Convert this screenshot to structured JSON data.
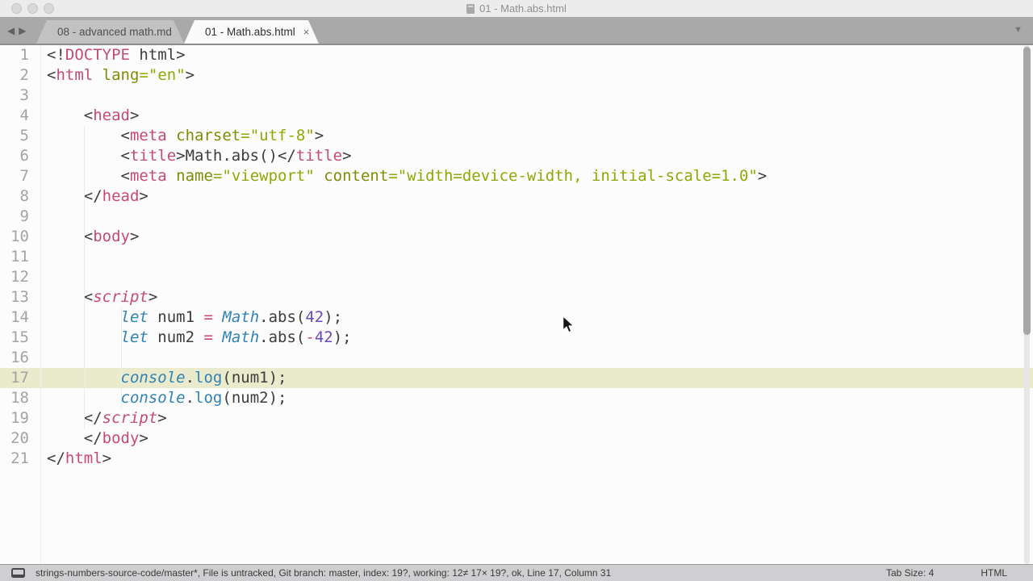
{
  "colors": {
    "c-tag": "#c64a72",
    "c-attr": "#7e8d01",
    "c-string": "#8ea903",
    "c-keyword": "#2f83b5",
    "c-func": "#2f83b5",
    "c-number": "#6a48b8",
    "c-operator": "#d0436f",
    "c-plain": "#3d3d3d",
    "c-linenum": "#a3a3a3",
    "c-highlight": "#eaeacc"
  },
  "window": {
    "title": "01 - Math.abs.html"
  },
  "icons": {
    "back": "◀",
    "forward": "▶",
    "overflow": "▼",
    "close": "×"
  },
  "tabs": [
    {
      "label": "08 - advanced math.md"
    },
    {
      "label": "01 - Math.abs.html"
    }
  ],
  "editor": {
    "highlighted_line": 17,
    "lines": [
      {
        "num": 1,
        "tokens": [
          [
            "p",
            "<!"
          ],
          [
            "t",
            "DOCTYPE"
          ],
          [
            "p",
            " html>"
          ]
        ]
      },
      {
        "num": 2,
        "tokens": [
          [
            "p",
            "<"
          ],
          [
            "t",
            "html"
          ],
          [
            "p",
            " "
          ],
          [
            "a",
            "lang"
          ],
          [
            "s",
            "=\"en\""
          ],
          [
            "p",
            ">"
          ]
        ]
      },
      {
        "num": 3,
        "tokens": []
      },
      {
        "num": 4,
        "tokens": [
          [
            "p",
            "    <"
          ],
          [
            "t",
            "head"
          ],
          [
            "p",
            ">"
          ]
        ]
      },
      {
        "num": 5,
        "tokens": [
          [
            "p",
            "        <"
          ],
          [
            "t",
            "meta"
          ],
          [
            "p",
            " "
          ],
          [
            "a",
            "charset"
          ],
          [
            "s",
            "=\"utf-8\""
          ],
          [
            "p",
            ">"
          ]
        ]
      },
      {
        "num": 6,
        "tokens": [
          [
            "p",
            "        <"
          ],
          [
            "t",
            "title"
          ],
          [
            "p",
            ">Math.abs()</"
          ],
          [
            "t",
            "title"
          ],
          [
            "p",
            ">"
          ]
        ]
      },
      {
        "num": 7,
        "tokens": [
          [
            "p",
            "        <"
          ],
          [
            "t",
            "meta"
          ],
          [
            "p",
            " "
          ],
          [
            "a",
            "name"
          ],
          [
            "s",
            "=\"viewport\""
          ],
          [
            "p",
            " "
          ],
          [
            "a",
            "content"
          ],
          [
            "s",
            "=\"width=device-width, initial-scale=1.0\""
          ],
          [
            "p",
            ">"
          ]
        ]
      },
      {
        "num": 8,
        "tokens": [
          [
            "p",
            "    </"
          ],
          [
            "t",
            "head"
          ],
          [
            "p",
            ">"
          ]
        ]
      },
      {
        "num": 9,
        "tokens": []
      },
      {
        "num": 10,
        "tokens": [
          [
            "p",
            "    <"
          ],
          [
            "t",
            "body"
          ],
          [
            "p",
            ">"
          ]
        ]
      },
      {
        "num": 11,
        "tokens": []
      },
      {
        "num": 12,
        "tokens": []
      },
      {
        "num": 13,
        "tokens": [
          [
            "p",
            "    <"
          ],
          [
            "ti",
            "script"
          ],
          [
            "p",
            ">"
          ]
        ]
      },
      {
        "num": 14,
        "tokens": [
          [
            "p",
            "        "
          ],
          [
            "k",
            "let"
          ],
          [
            "p",
            " num1 "
          ],
          [
            "o",
            "="
          ],
          [
            "p",
            " "
          ],
          [
            "k",
            "Math"
          ],
          [
            "p",
            ".abs("
          ],
          [
            "n",
            "42"
          ],
          [
            "p",
            ");"
          ]
        ]
      },
      {
        "num": 15,
        "tokens": [
          [
            "p",
            "        "
          ],
          [
            "k",
            "let"
          ],
          [
            "p",
            " num2 "
          ],
          [
            "o",
            "="
          ],
          [
            "p",
            " "
          ],
          [
            "k",
            "Math"
          ],
          [
            "p",
            ".abs("
          ],
          [
            "o",
            "-"
          ],
          [
            "n",
            "42"
          ],
          [
            "p",
            ");"
          ]
        ]
      },
      {
        "num": 16,
        "tokens": []
      },
      {
        "num": 17,
        "tokens": [
          [
            "p",
            "        "
          ],
          [
            "k",
            "console"
          ],
          [
            "p",
            "."
          ],
          [
            "f",
            "log"
          ],
          [
            "p",
            "(num1);"
          ]
        ]
      },
      {
        "num": 18,
        "tokens": [
          [
            "p",
            "        "
          ],
          [
            "k",
            "console"
          ],
          [
            "p",
            "."
          ],
          [
            "f",
            "log"
          ],
          [
            "p",
            "(num2);"
          ]
        ]
      },
      {
        "num": 19,
        "tokens": [
          [
            "p",
            "    </"
          ],
          [
            "ti",
            "script"
          ],
          [
            "p",
            ">"
          ]
        ]
      },
      {
        "num": 20,
        "tokens": [
          [
            "p",
            "    </"
          ],
          [
            "t",
            "body"
          ],
          [
            "p",
            ">"
          ]
        ]
      },
      {
        "num": 21,
        "tokens": [
          [
            "p",
            "</"
          ],
          [
            "t",
            "html"
          ],
          [
            "p",
            ">"
          ]
        ]
      }
    ]
  },
  "status_bar": {
    "text": "strings-numbers-source-code/master*, File is untracked, Git branch: master, index: 19?, working: 12≠ 17× 19?, ok, Line 17, Column 31",
    "tab_size": "Tab Size: 4",
    "syntax": "HTML"
  }
}
